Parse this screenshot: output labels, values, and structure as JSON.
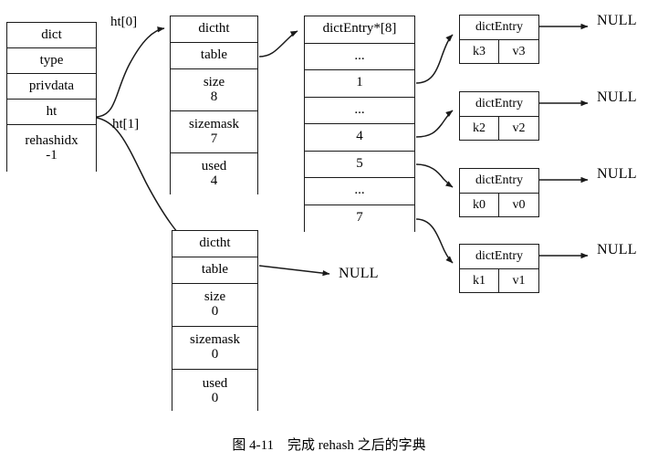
{
  "figure": {
    "caption": "图 4-11　完成 rehash 之后的字典"
  },
  "dict_struct": {
    "name": "dict-struct",
    "rows": [
      {
        "label": "dict",
        "value": ""
      },
      {
        "label": "type",
        "value": ""
      },
      {
        "label": "privdata",
        "value": ""
      },
      {
        "label": "ht",
        "value": ""
      },
      {
        "label": "rehashidx",
        "value": "-1"
      }
    ]
  },
  "edge_labels": {
    "ht0": "ht[0]",
    "ht1": "ht[1]"
  },
  "dictht0": {
    "rows": [
      {
        "label": "dictht",
        "value": ""
      },
      {
        "label": "table",
        "value": ""
      },
      {
        "label": "size",
        "value": "8"
      },
      {
        "label": "sizemask",
        "value": "7"
      },
      {
        "label": "used",
        "value": "4"
      }
    ]
  },
  "dictht1": {
    "rows": [
      {
        "label": "dictht",
        "value": ""
      },
      {
        "label": "table",
        "value": ""
      },
      {
        "label": "size",
        "value": "0"
      },
      {
        "label": "sizemask",
        "value": "0"
      },
      {
        "label": "used",
        "value": "0"
      }
    ]
  },
  "bucket_array": {
    "header": "dictEntry*[8]",
    "rows": [
      "...",
      "1",
      "...",
      "4",
      "5",
      "...",
      "7"
    ]
  },
  "entries": [
    {
      "header": "dictEntry",
      "key": "k3",
      "value": "v3",
      "next": "NULL"
    },
    {
      "header": "dictEntry",
      "key": "k2",
      "value": "v2",
      "next": "NULL"
    },
    {
      "header": "dictEntry",
      "key": "k0",
      "value": "v0",
      "next": "NULL"
    },
    {
      "header": "dictEntry",
      "key": "k1",
      "value": "v1",
      "next": "NULL"
    }
  ],
  "ht1_table_target": "NULL",
  "colors": {
    "stroke": "#1a1a1a",
    "background": "#ffffff",
    "text": "#000000"
  }
}
